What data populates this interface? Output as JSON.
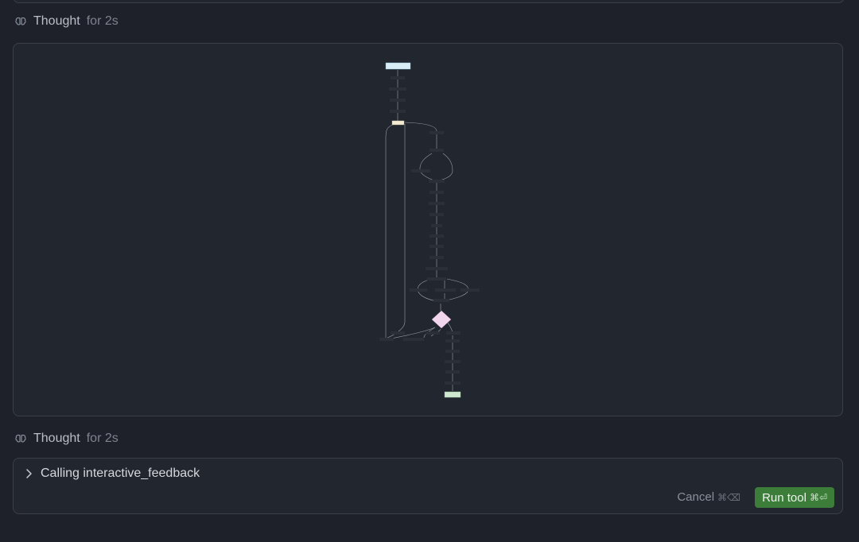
{
  "thought_1": {
    "label": "Thought",
    "duration": "for 2s",
    "icon": "brain-icon"
  },
  "thought_2": {
    "label": "Thought",
    "duration": "for 2s",
    "icon": "brain-icon"
  },
  "tool_call": {
    "label": "Calling interactive_feedback",
    "expand_icon": "chevron-right-icon",
    "cancel_label": "Cancel",
    "cancel_shortcut": "⌘⌫",
    "run_label": "Run tool",
    "run_shortcut": "⌘⏎"
  },
  "colors": {
    "background": "#1e2129",
    "card": "#22262e",
    "border": "#3a3f4a",
    "run_button": "#3c7d3a",
    "start_node": "#d8ecf5",
    "decision_node": "#f2d6ee",
    "end_node": "#cfe6cf"
  }
}
